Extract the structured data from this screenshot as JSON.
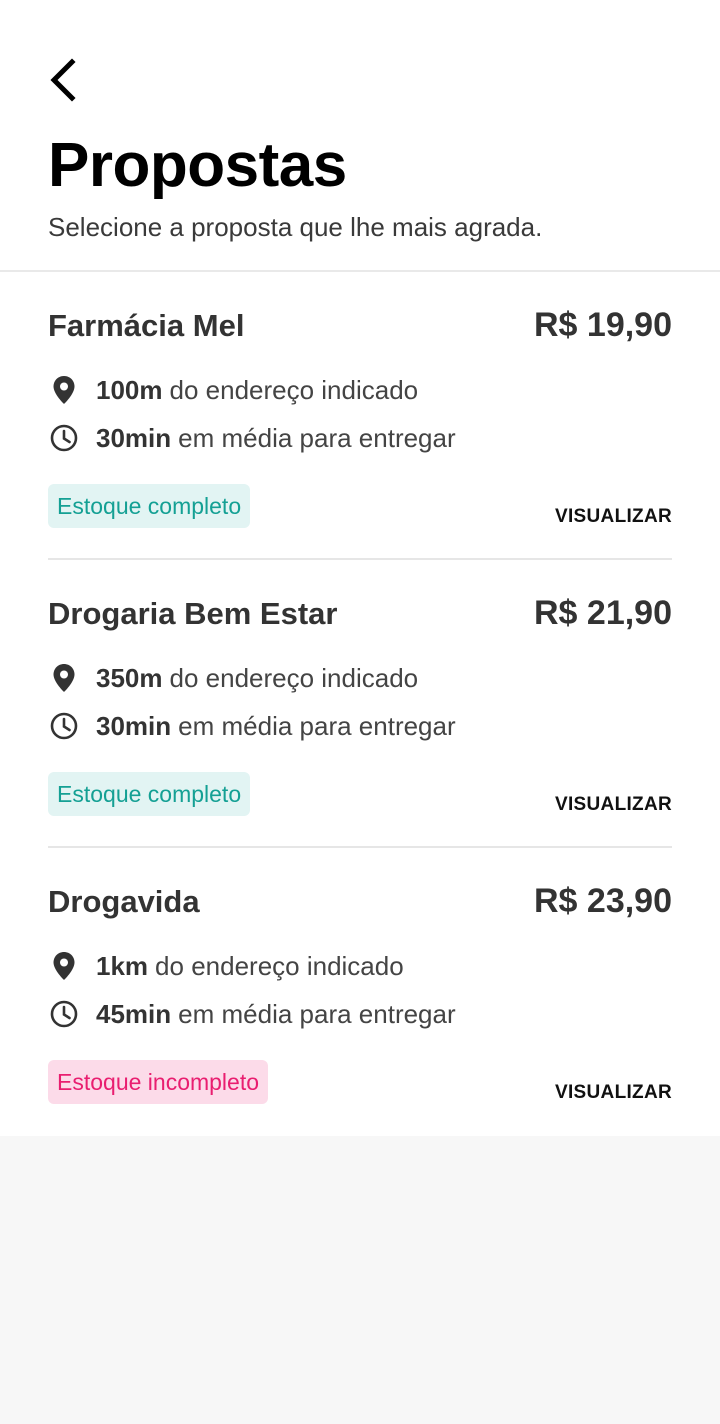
{
  "header": {
    "title": "Propostas",
    "subtitle": "Selecione a proposta que lhe mais agrada.",
    "back_icon": "chevron-left-icon"
  },
  "proposals": [
    {
      "name": "Farmácia Mel",
      "price": "R$ 19,90",
      "distance": "100m",
      "distance_suffix": "do endereço indicado",
      "time": "30min",
      "time_suffix": "em média para entregar",
      "stock": "Estoque completo",
      "stock_status": "complete",
      "action": "VISUALIZAR"
    },
    {
      "name": "Drogaria Bem Estar",
      "price": "R$ 21,90",
      "distance": "350m",
      "distance_suffix": "do endereço indicado",
      "time": "30min",
      "time_suffix": "em média para entregar",
      "stock": "Estoque completo",
      "stock_status": "complete",
      "action": "VISUALIZAR"
    },
    {
      "name": "Drogavida",
      "price": "R$ 23,90",
      "distance": "1km",
      "distance_suffix": "do endereço indicado",
      "time": "45min",
      "time_suffix": "em média para entregar",
      "stock": "Estoque incompleto",
      "stock_status": "incomplete",
      "action": "VISUALIZAR"
    }
  ],
  "colors": {
    "stock_complete_text": "#14a094",
    "stock_complete_bg": "#e2f4f3",
    "stock_incomplete_text": "#e91e70",
    "stock_incomplete_bg": "#fcdbe9"
  }
}
